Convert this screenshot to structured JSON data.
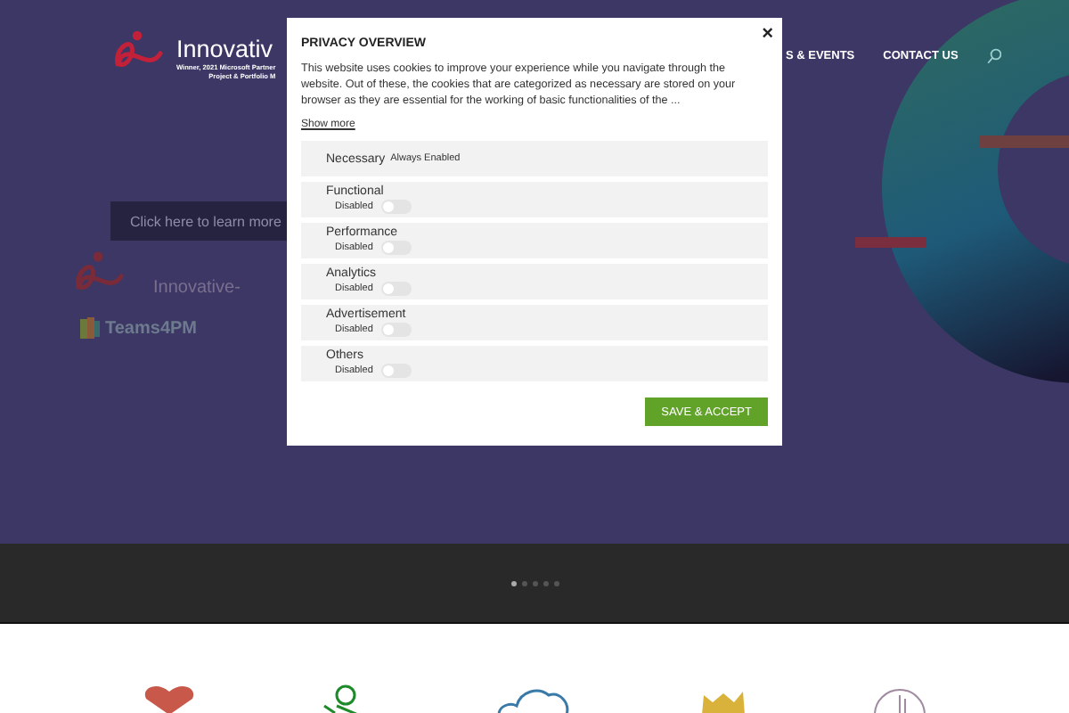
{
  "header": {
    "logo": {
      "name": "Innovativ",
      "tagline_1": "Winner, 2021 Microsoft Partner",
      "tagline_2": "Project & Portfolio M"
    },
    "nav": [
      {
        "label": "S & EVENTS"
      },
      {
        "label": "CONTACT US"
      }
    ]
  },
  "hero": {
    "button": "Click here to learn more",
    "partner_logos": [
      "Innovative-",
      "Teams4PM"
    ]
  },
  "slider": {
    "dots": [
      {
        "selected": true
      },
      {
        "selected": false
      },
      {
        "selected": false
      },
      {
        "selected": false
      },
      {
        "selected": false
      }
    ]
  },
  "modal": {
    "title": "PRIVACY OVERVIEW",
    "close": "×",
    "text": "This website uses cookies to improve your experience while you navigate through the website. Out of these, the cookies that are categorized as necessary are stored on your browser as they are essential for the working of basic functionalities of the ...",
    "show_more": "Show more",
    "categories": [
      {
        "kind": "fixed",
        "name": "Necessary",
        "status": "Always Enabled"
      },
      {
        "kind": "toggle",
        "name": "Functional",
        "status": "Disabled",
        "on": false
      },
      {
        "kind": "toggle",
        "name": "Performance",
        "status": "Disabled",
        "on": false
      },
      {
        "kind": "toggle",
        "name": "Analytics",
        "status": "Disabled",
        "on": false
      },
      {
        "kind": "toggle",
        "name": "Advertisement",
        "status": "Disabled",
        "on": false
      },
      {
        "kind": "toggle",
        "name": "Others",
        "status": "Disabled",
        "on": false
      }
    ],
    "button": "SAVE & ACCEPT"
  }
}
